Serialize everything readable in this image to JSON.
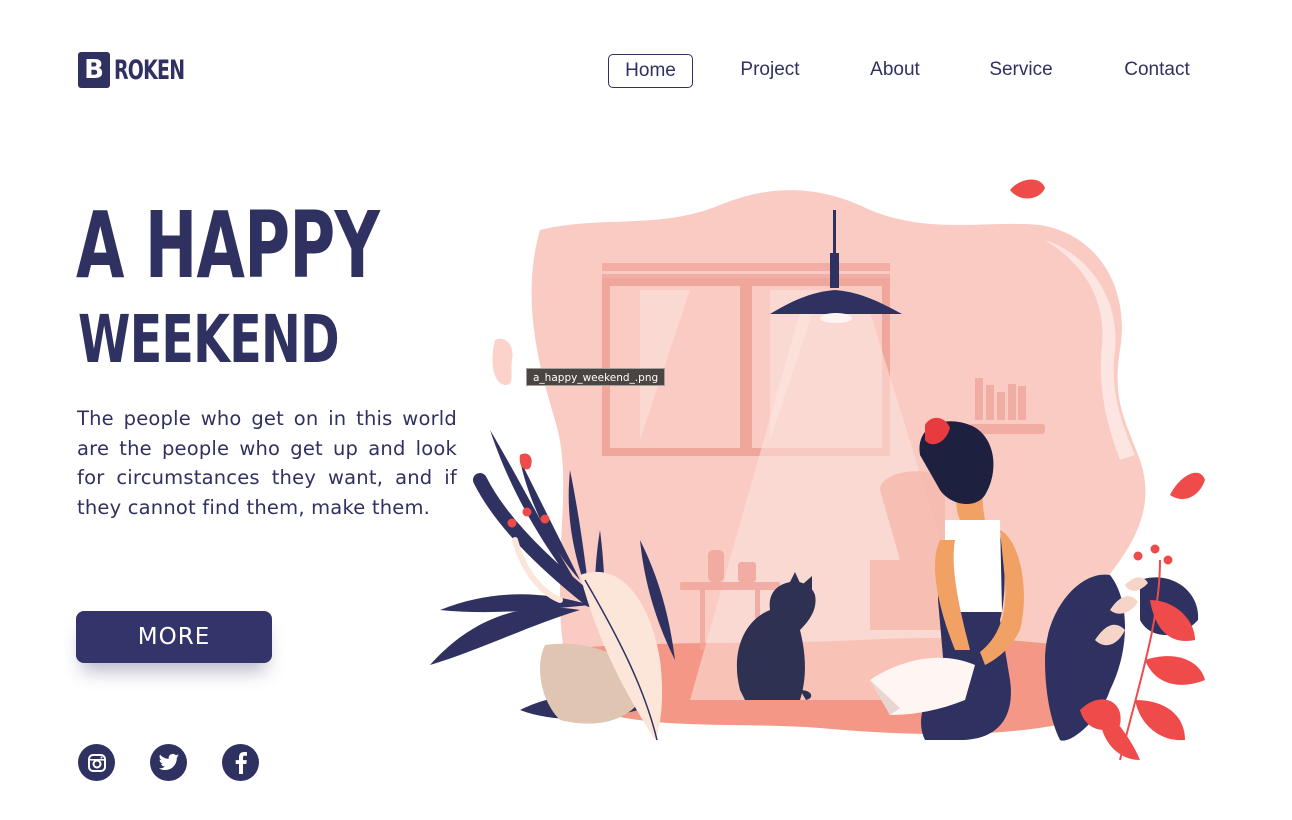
{
  "logo": {
    "letter": "B",
    "rest": "ROKEN"
  },
  "nav": {
    "items": [
      {
        "id": "home",
        "label": "Home",
        "active": true
      },
      {
        "id": "project",
        "label": "Project",
        "active": false
      },
      {
        "id": "about",
        "label": "About",
        "active": false
      },
      {
        "id": "service",
        "label": "Service",
        "active": false
      },
      {
        "id": "contact",
        "label": "Contact",
        "active": false
      }
    ]
  },
  "hero": {
    "title_line1": "A HAPPY",
    "title_line2": "WEEKEND",
    "description": "The people who get on in this world are the people who get up and look for circumstances they want, and if they cannot find them, make them.",
    "button_label": "MORE"
  },
  "social": [
    {
      "name": "instagram-icon"
    },
    {
      "name": "twitter-icon"
    },
    {
      "name": "facebook-icon"
    }
  ],
  "illustration": {
    "filename_tooltip": "a_happy_weekend_.png"
  },
  "colors": {
    "brand_navy": "#2f3160",
    "blob_pink": "#f8c9c0",
    "accent_red": "#ef4b4b",
    "floor_salmon": "#f49786"
  }
}
